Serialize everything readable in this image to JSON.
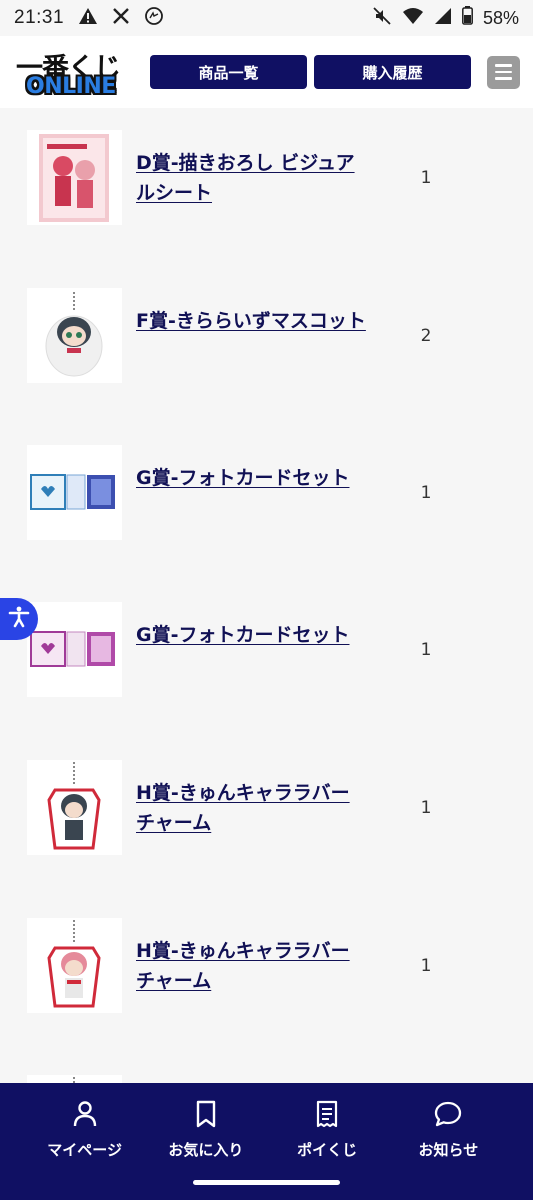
{
  "status_bar": {
    "time": "21:31",
    "battery": "58%"
  },
  "header": {
    "logo_top": "一番くじ",
    "logo_bottom": "ONLINE",
    "products_label": "商品一覧",
    "history_label": "購入履歴"
  },
  "items": [
    {
      "name": "D賞-描きおろし ビジュアルシート",
      "qty": "1"
    },
    {
      "name": "F賞-きららいずマスコット",
      "qty": "2"
    },
    {
      "name": "G賞-フォトカードセット",
      "qty": "1"
    },
    {
      "name": "G賞-フォトカードセット",
      "qty": "1"
    },
    {
      "name": "H賞-きゅんキャララバーチャーム",
      "qty": "1"
    },
    {
      "name": "H賞-きゅんキャララバーチャーム",
      "qty": "1"
    }
  ],
  "bottom_nav": [
    {
      "label": "マイページ",
      "icon": "person-icon"
    },
    {
      "label": "お気に入り",
      "icon": "bookmark-icon"
    },
    {
      "label": "ポイくじ",
      "icon": "receipt-icon"
    },
    {
      "label": "お知らせ",
      "icon": "chat-bubble-icon"
    }
  ],
  "colors": {
    "nav_bg": "#101063",
    "link": "#111155",
    "accessibility": "#2a44e5"
  }
}
